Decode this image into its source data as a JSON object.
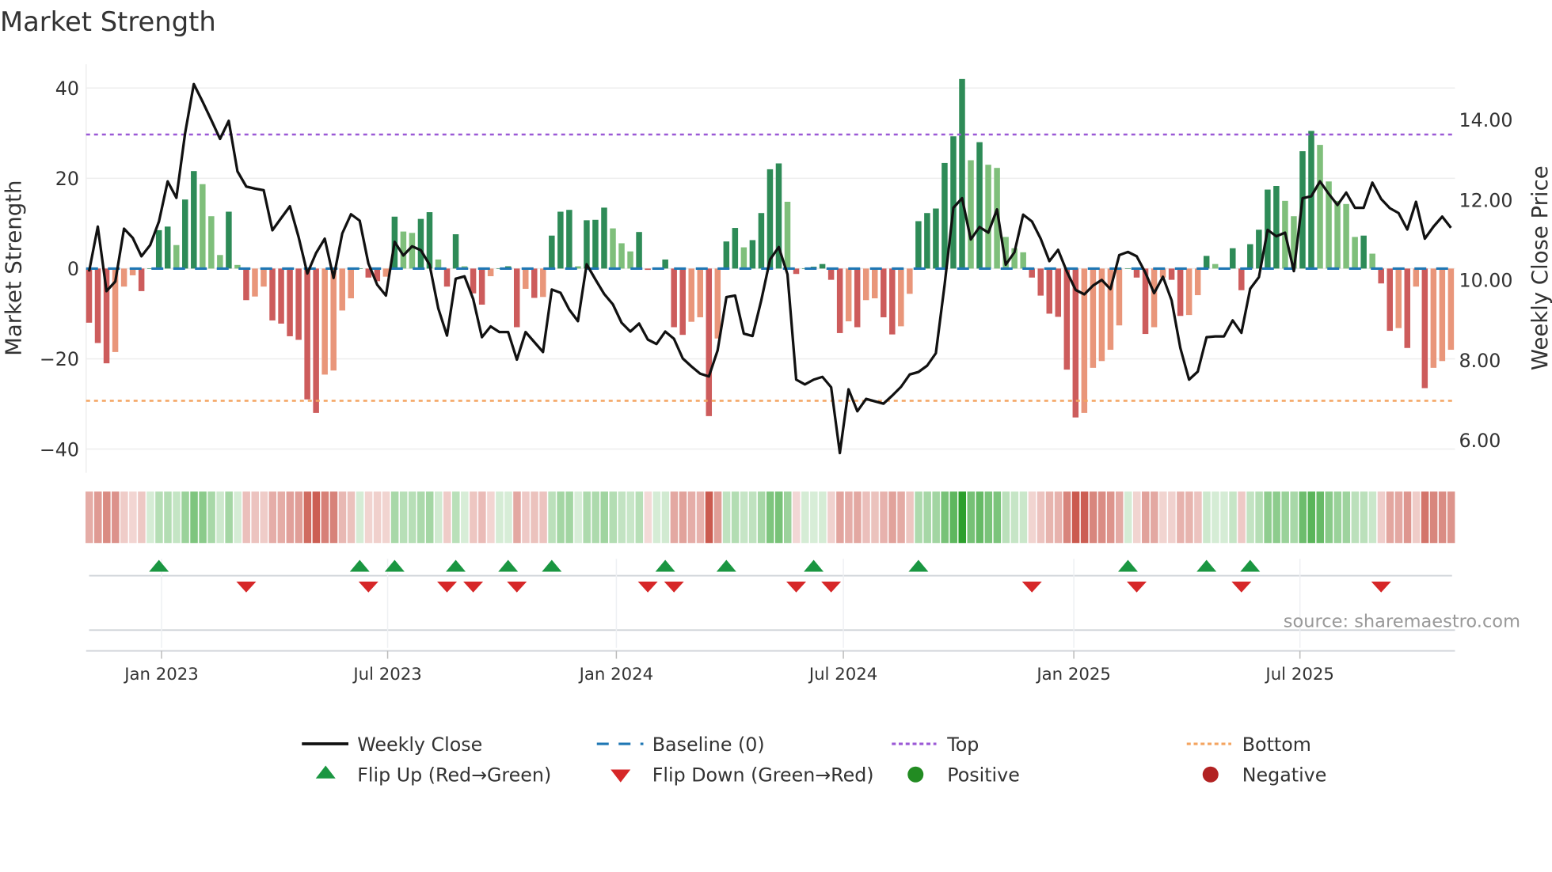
{
  "title": "Market Strength",
  "source": "source: sharemaestro.com",
  "colors": {
    "pos_strong": "#2e8b57",
    "pos_weak": "#7fbf7b",
    "neg_strong": "#cd5c5c",
    "neg_weak": "#e9967a",
    "baseline": "#1f77b4",
    "top": "#9b59d6",
    "bottom": "#f4a460",
    "flip_up": "#1a9641",
    "flip_down": "#d62728",
    "positive": "#228b22",
    "negative": "#b22222",
    "line": "#111111"
  },
  "legend": {
    "weekly_close": "Weekly Close",
    "baseline": "Baseline (0)",
    "top": "Top",
    "bottom": "Bottom",
    "flip_up": "Flip Up (Red→Green)",
    "flip_down": "Flip Down (Green→Red)",
    "positive": "Positive",
    "negative": "Negative"
  },
  "chart_data": {
    "type": "bar",
    "title": "Market Strength",
    "ylabel": "Market Strength",
    "y2label": "Weekly Close Price",
    "ylim": [
      -45,
      44
    ],
    "y2lim": [
      5.4,
      15.6
    ],
    "yticks": [
      {
        "v": 40,
        "label": "40"
      },
      {
        "v": 20,
        "label": "20"
      },
      {
        "v": 0,
        "label": "0"
      },
      {
        "v": -20,
        "label": "−20"
      },
      {
        "v": -40,
        "label": "−40"
      }
    ],
    "y2ticks": [
      {
        "v": 14,
        "label": "14.00"
      },
      {
        "v": 12,
        "label": "12.00"
      },
      {
        "v": 10,
        "label": "10.00"
      },
      {
        "v": 8,
        "label": "8.00"
      },
      {
        "v": 6,
        "label": "6.00"
      }
    ],
    "xticks": [
      {
        "week": 8.3,
        "label": "Jan 2023"
      },
      {
        "week": 34.2,
        "label": "Jul 2023"
      },
      {
        "week": 60.4,
        "label": "Jan 2024"
      },
      {
        "week": 86.4,
        "label": "Jul 2024"
      },
      {
        "week": 112.8,
        "label": "Jan 2025"
      },
      {
        "week": 138.7,
        "label": "Jul 2025"
      }
    ],
    "top_level": 29.7,
    "bottom_level": -29.3,
    "baseline": 0,
    "strength": [
      -12,
      -16.5,
      -21,
      -18.5,
      -4,
      -1.5,
      -5,
      0,
      8.5,
      9.3,
      5.2,
      15.3,
      21.6,
      18.7,
      11.6,
      3,
      12.6,
      0.8,
      -7,
      -6.2,
      -4,
      -11.5,
      -12.2,
      -15,
      -15.8,
      -29,
      -32,
      -23.5,
      -22.6,
      -9.3,
      -6.6,
      0,
      -2,
      -2.8,
      -1.8,
      11.5,
      8.2,
      7.9,
      11,
      12.5,
      2,
      -4,
      7.6,
      0.5,
      -5.5,
      -8,
      -1.7,
      0,
      0.5,
      -13,
      -4.5,
      -6.5,
      -6.3,
      7.3,
      12.6,
      13,
      0.5,
      10.7,
      10.8,
      13.5,
      8.9,
      5.6,
      3.8,
      8.1,
      -0.3,
      0,
      2,
      -13,
      -14.7,
      -11.8,
      -10.8,
      -32.7,
      -15.5,
      6,
      9,
      4.7,
      6.3,
      12.3,
      22,
      23.3,
      14.8,
      -1.2,
      0,
      0.4,
      1,
      -2.5,
      -14.3,
      -11.7,
      -13,
      -7,
      -6.6,
      -10.8,
      -14.6,
      -12.8,
      -5.6,
      10.5,
      12.3,
      13.3,
      23.4,
      29.3,
      42,
      24,
      28,
      23,
      22.3,
      7,
      4.5,
      3.6,
      -2,
      -6,
      -10,
      -10.7,
      -22.4,
      -33,
      -32,
      -22,
      -20.5,
      -18,
      -12.6,
      0,
      -2,
      -14.5,
      -13,
      -2,
      -2.5,
      -10.5,
      -10.3,
      -5.9,
      2.8,
      1,
      0,
      4.5,
      -4.8,
      5.4,
      8.6,
      17.5,
      18.3,
      15,
      11.6,
      26,
      30.5,
      27.4,
      19.3,
      15,
      14.3,
      7,
      7.3,
      3.3,
      -3.3,
      -13.8,
      -13.2,
      -17.6,
      -4,
      -26.5,
      -22,
      -20.5,
      -18
    ],
    "weekly_close": [
      10.21,
      11.33,
      9.72,
      9.96,
      11.28,
      11.05,
      10.59,
      10.87,
      11.46,
      12.46,
      12.05,
      13.66,
      14.89,
      14.45,
      13.99,
      13.52,
      13.97,
      12.71,
      12.33,
      12.28,
      12.24,
      11.24,
      11.54,
      11.84,
      11.07,
      10.16,
      10.67,
      11.03,
      10.05,
      11.16,
      11.64,
      11.48,
      10.41,
      9.88,
      9.61,
      10.95,
      10.61,
      10.84,
      10.74,
      10.38,
      9.29,
      8.61,
      10.03,
      10.09,
      9.52,
      8.57,
      8.84,
      8.7,
      8.7,
      8.01,
      8.7,
      8.45,
      8.2,
      9.76,
      9.68,
      9.26,
      8.97,
      10.39,
      10.01,
      9.65,
      9.39,
      8.93,
      8.71,
      8.91,
      8.51,
      8.4,
      8.71,
      8.53,
      8.04,
      7.84,
      7.66,
      7.59,
      8.24,
      9.57,
      9.61,
      8.66,
      8.6,
      9.49,
      10.51,
      10.82,
      10.14,
      7.51,
      7.39,
      7.51,
      7.58,
      7.32,
      5.68,
      7.27,
      6.72,
      7.03,
      6.97,
      6.91,
      7.11,
      7.33,
      7.64,
      7.7,
      7.86,
      8.17,
      9.89,
      11.8,
      12.04,
      11.01,
      11.32,
      11.18,
      11.76,
      10.38,
      10.69,
      11.63,
      11.46,
      11.03,
      10.47,
      10.75,
      10.21,
      9.75,
      9.64,
      9.86,
      10.0,
      9.77,
      10.62,
      10.7,
      10.59,
      10.18,
      9.67,
      10.08,
      9.49,
      8.3,
      7.51,
      7.71,
      8.57,
      8.59,
      8.59,
      8.99,
      8.68,
      9.78,
      10.07,
      11.25,
      11.09,
      11.18,
      10.22,
      12.04,
      12.09,
      12.46,
      12.15,
      11.87,
      12.18,
      11.8,
      11.8,
      12.43,
      12.02,
      11.79,
      11.67,
      11.26,
      11.95,
      11.03,
      11.33,
      11.58,
      11.3
    ],
    "flip_up_weeks": [
      8,
      31,
      35,
      42,
      48,
      53,
      66,
      73,
      83,
      95,
      119,
      128,
      133
    ],
    "flip_down_weeks": [
      18,
      32,
      41,
      44,
      49,
      64,
      67,
      81,
      85,
      108,
      120,
      132,
      148
    ],
    "legend_position": "bottom"
  }
}
